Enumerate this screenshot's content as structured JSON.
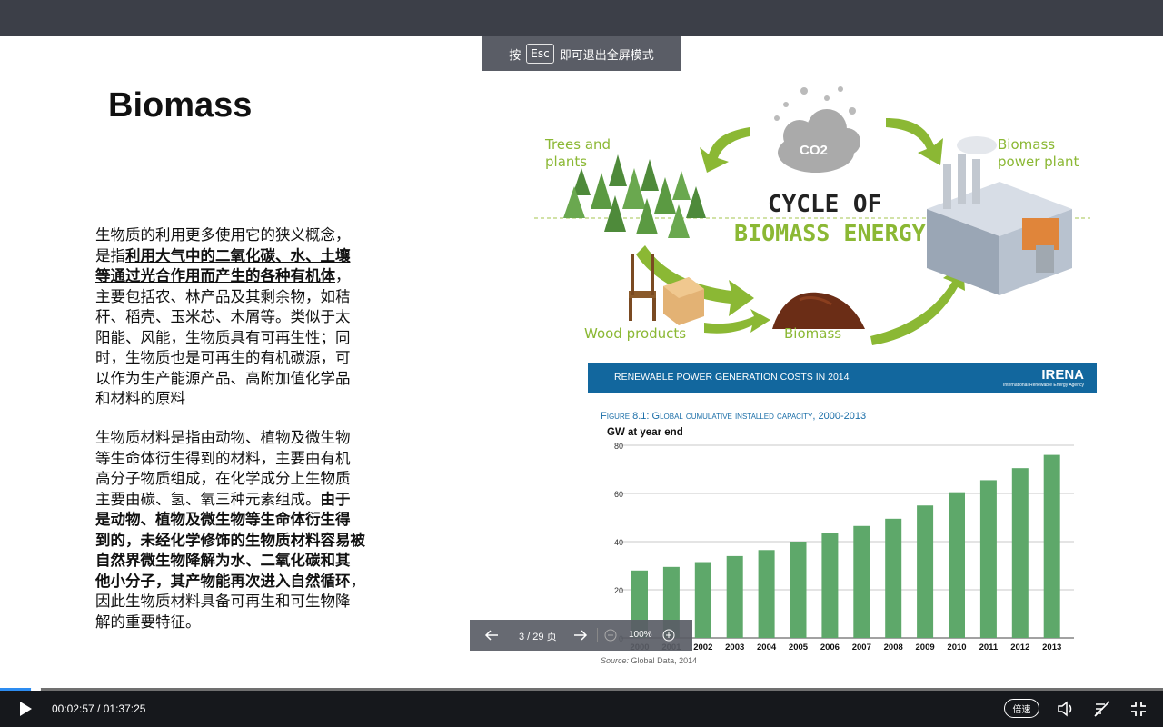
{
  "esc_hint": {
    "prefix": "按",
    "key": "Esc",
    "suffix": "即可退出全屏模式"
  },
  "slide": {
    "title": "Biomass",
    "para1": {
      "l1": "生物质的利用更多使用它的狭义概念，",
      "l2_pre": "是指",
      "l2_bold": "利用大气中的二氧化碳、水、土壤",
      "l3_bold": "等通过光合作用而产生的各种有机体",
      "l3_post": "，",
      "l4": "主要包括农、林产品及其剩余物，如秸",
      "l5": "秆、稻壳、玉米芯、木屑等。类似于太",
      "l6": "阳能、风能，生物质具有可再生性；同",
      "l7": "时，生物质也是可再生的有机碳源，可",
      "l8": "以作为生产能源产品、高附加值化学品",
      "l9": "和材料的原料"
    },
    "para2": {
      "l1": "生物质材料是指由动物、植物及微生物",
      "l2": "等生命体衍生得到的材料，主要由有机",
      "l3": "高分子物质组成，在化学成分上生物质",
      "l4_pre": "主要由碳、氢、氧三种元素组成。",
      "l4_bold": "由于",
      "l5_bold": "是动物、植物及微生物等生命体衍生得",
      "l6_bold": "到的，未经化学修饰的生物质材料容易被",
      "l7_bold": "自然界微生物降解为水、二氧化碳和其",
      "l8_bold": "他小分子，其产物能再次进入自然循环",
      "l8_post": "，",
      "l9": "因此生物质材料具备可再生和可生物降",
      "l10": "解的重要特征。"
    }
  },
  "cycle_diagram": {
    "title_line1": "CYCLE OF",
    "title_line2": "BIOMASS ENERGY",
    "co2": "CO2",
    "trees_label_1": "Trees and",
    "trees_label_2": "plants",
    "power_label_1": "Biomass",
    "power_label_2": "power plant",
    "wood_label": "Wood products",
    "biomass_label": "Biomass",
    "accent_color": "#8bb834"
  },
  "irena": {
    "header_title": "RENEWABLE POWER GENERATION COSTS IN 2014",
    "logo_text": "IRENA",
    "logo_sub": "International Renewable Energy Agency",
    "figure_caption": "Figure 8.1: Global cumulative installed capacity, 2000-2013",
    "source_label": "Source:",
    "source_text": "Global Data, 2014",
    "header_color": "#12679e"
  },
  "chart_data": {
    "type": "bar",
    "title": "",
    "ylabel": "GW at year end",
    "xlabel": "",
    "categories": [
      "2000",
      "2001",
      "2002",
      "2003",
      "2004",
      "2005",
      "2006",
      "2007",
      "2008",
      "2009",
      "2010",
      "2011",
      "2012",
      "2013"
    ],
    "values": [
      28,
      29.5,
      31.5,
      34,
      36.5,
      40,
      43.5,
      46.5,
      49.5,
      55,
      60.5,
      65.5,
      70.5,
      76
    ],
    "ylim": [
      0,
      80
    ],
    "yticks": [
      0,
      20,
      40,
      60,
      80
    ],
    "grid": true,
    "bar_color": "#5ea86a"
  },
  "pager": {
    "page_text": "3 / 29 页",
    "zoom": "100%"
  },
  "player": {
    "current_time": "00:02:57",
    "separator": " / ",
    "total_time": "01:37:25",
    "speed_label": "倍速",
    "progress_fraction": 0.0303,
    "progress_color": "#2d8cf0"
  },
  "icons": [
    "play-icon",
    "volume-icon",
    "danmaku-off-icon",
    "exit-fullscreen-icon",
    "arrow-left-icon",
    "arrow-right-icon",
    "zoom-out-icon",
    "zoom-in-icon"
  ]
}
